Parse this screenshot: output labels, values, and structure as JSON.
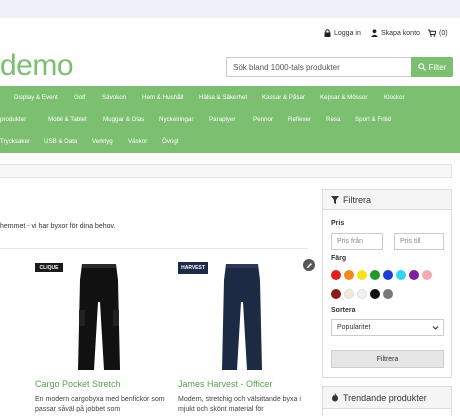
{
  "header": {
    "login_label": "Logga in",
    "register_label": "Skapa konto",
    "cart_count": "(0)",
    "logo_text": "demo"
  },
  "search": {
    "placeholder": "Sök bland 1000-tals produkter",
    "button_label": "Filter"
  },
  "categories": {
    "row1": [
      "Display & Event",
      "Golf",
      "Sävokon",
      "Hem & Hushåll",
      "Hälsa & Säkerhet",
      "Kassar & Påsar",
      "Kepsar & Mössor",
      "Klockor"
    ],
    "row2": [
      "produkter",
      "Mobil & Tablet",
      "Muggar & Glas",
      "Nyckelringar",
      "Paraplyer",
      "Pennor",
      "Reflexer",
      "Resa",
      "Sport & Fritid"
    ],
    "row3": [
      "Trycksaker",
      "USB & Data",
      "Verktyg",
      "Väskor",
      "Övrigt"
    ]
  },
  "intro_text": "hemmet - vi har byxor för dina behov.",
  "products": [
    {
      "brand": "CLIQUE",
      "title": "Cargo Pocket Stretch",
      "desc": "En modern cargobyxa med benfickor som passar såväl på jobbet som"
    },
    {
      "brand": "HARVEST",
      "title": "James Harvest - Officer",
      "desc": "Modern, stretchig och välsittande byxa i mjukt och skönt material för"
    }
  ],
  "filter": {
    "title": "Filtrera",
    "price_label": "Pris",
    "price_from_placeholder": "Pris från",
    "price_to_placeholder": "Pris till",
    "color_label": "Färg",
    "colors": [
      "#e41f1f",
      "#f28a1a",
      "#f5e21b",
      "#1f9a2a",
      "#1f3bd6",
      "#32d4f0",
      "#7d1fa0",
      "#f2aab8",
      "#8b1a1a",
      "#eeeed8",
      "#f0f0f0",
      "#111111",
      "#777777"
    ],
    "sort_label": "Sortera",
    "sort_value": "Popularitet",
    "apply_label": "Filtrera"
  },
  "trending": {
    "title": "Trendande produkter"
  }
}
